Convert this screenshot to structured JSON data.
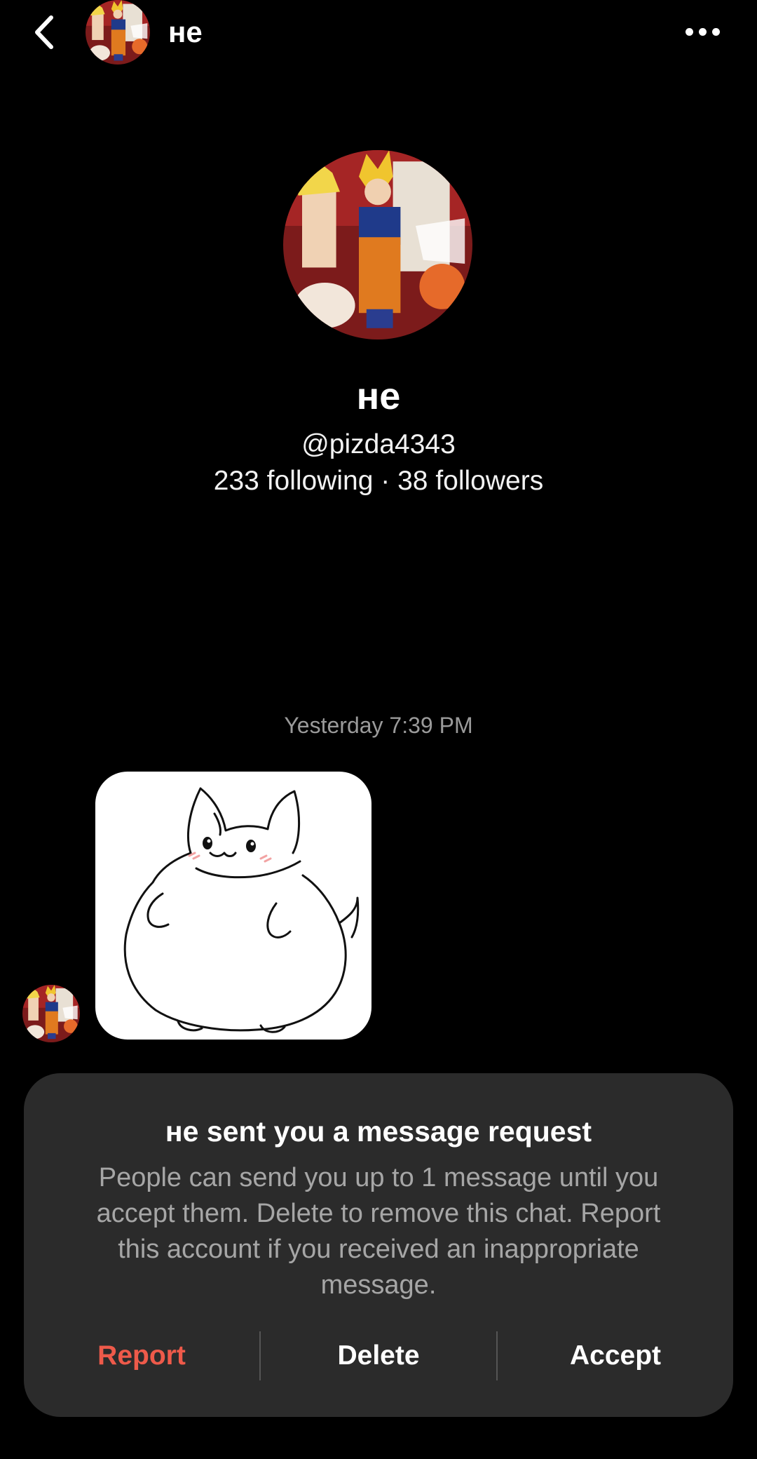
{
  "header": {
    "title": "не",
    "back_icon": "chevron-left-icon",
    "more_icon": "ellipsis-icon"
  },
  "profile": {
    "name": "не",
    "handle": "@pizda4343",
    "stats": "233 following · 38 followers"
  },
  "conversation": {
    "timestamp": "Yesterday 7:39 PM",
    "message": {
      "type": "sticker"
    }
  },
  "request": {
    "title": "не sent you a message request",
    "body": "People can send you up to 1 message until you accept them. Delete to remove this chat. Report this account if you received an inappropriate message.",
    "actions": {
      "report": "Report",
      "delete": "Delete",
      "accept": "Accept"
    }
  },
  "colors": {
    "background": "#000000",
    "card": "#2b2b2b",
    "report": "#ee5a4a",
    "muted_text": "#a6a6a6"
  }
}
